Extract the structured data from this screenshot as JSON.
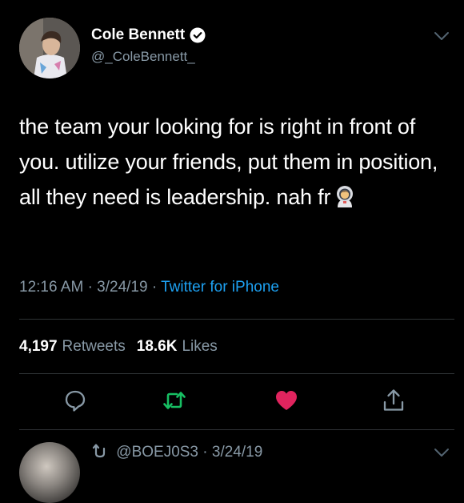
{
  "author": {
    "display_name": "Cole Bennett",
    "handle": "@_ColeBennett_",
    "verified": true
  },
  "tweet": {
    "text": "the team your looking for is right in front of you. utilize your friends, put them in position, all they need is leadership. nah fr",
    "emoji": "astronaut-emoji",
    "time": "12:16 AM",
    "date": "3/24/19",
    "separator": "·",
    "source": "Twitter for iPhone"
  },
  "stats": {
    "retweets_count": "4,197",
    "retweets_label": "Retweets",
    "likes_count": "18.6K",
    "likes_label": "Likes"
  },
  "actions": [
    "reply-icon",
    "retweet-icon",
    "like-icon",
    "share-icon"
  ],
  "next_tweet": {
    "handle": "@BOEJ0S3",
    "date": "3/24/19",
    "separator": "·"
  },
  "colors": {
    "background": "#000000",
    "text": "#ffffff",
    "secondary": "#8899a6",
    "link": "#1da1f2",
    "retweet": "#17bf63",
    "like": "#e0245e",
    "divider": "#2f3336"
  }
}
